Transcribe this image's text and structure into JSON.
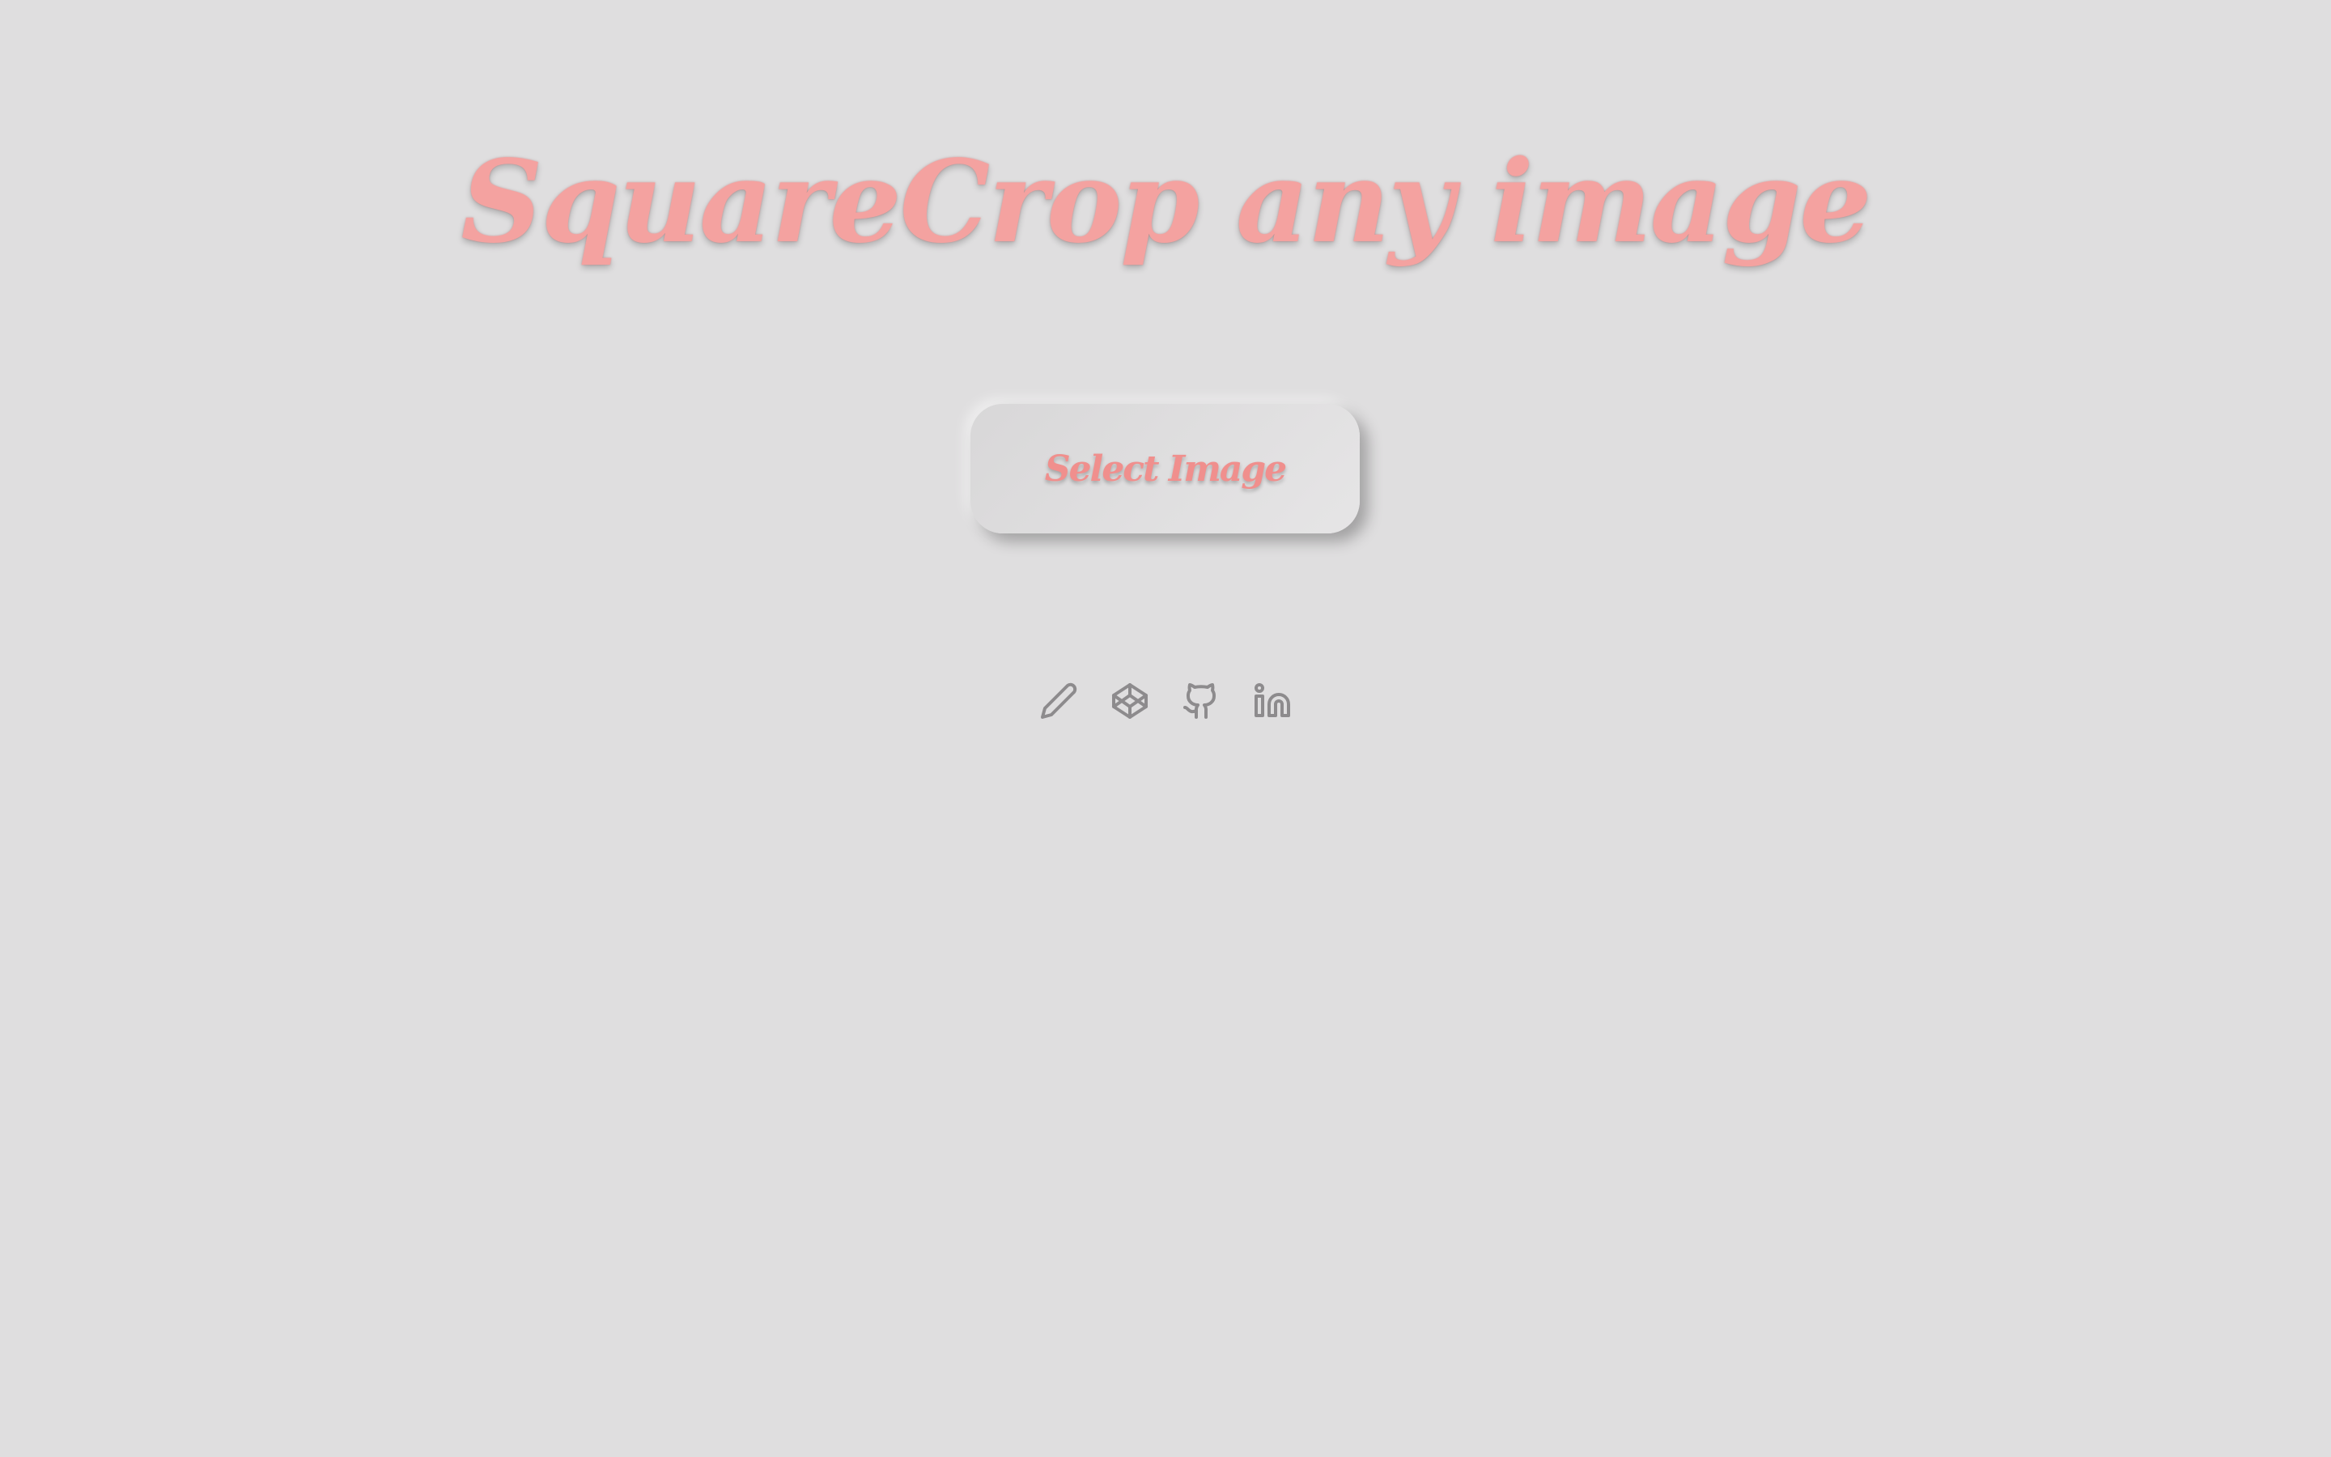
{
  "header": {
    "title": "SquareCrop any image"
  },
  "main": {
    "select_button_label": "Select Image"
  },
  "social_links": [
    {
      "icon": "pencil-icon"
    },
    {
      "icon": "codepen-icon"
    },
    {
      "icon": "github-icon"
    },
    {
      "icon": "linkedin-icon"
    }
  ],
  "colors": {
    "background": "#dfdedf",
    "accent": "#f4a2a0",
    "icon": "#8d8b8d"
  }
}
